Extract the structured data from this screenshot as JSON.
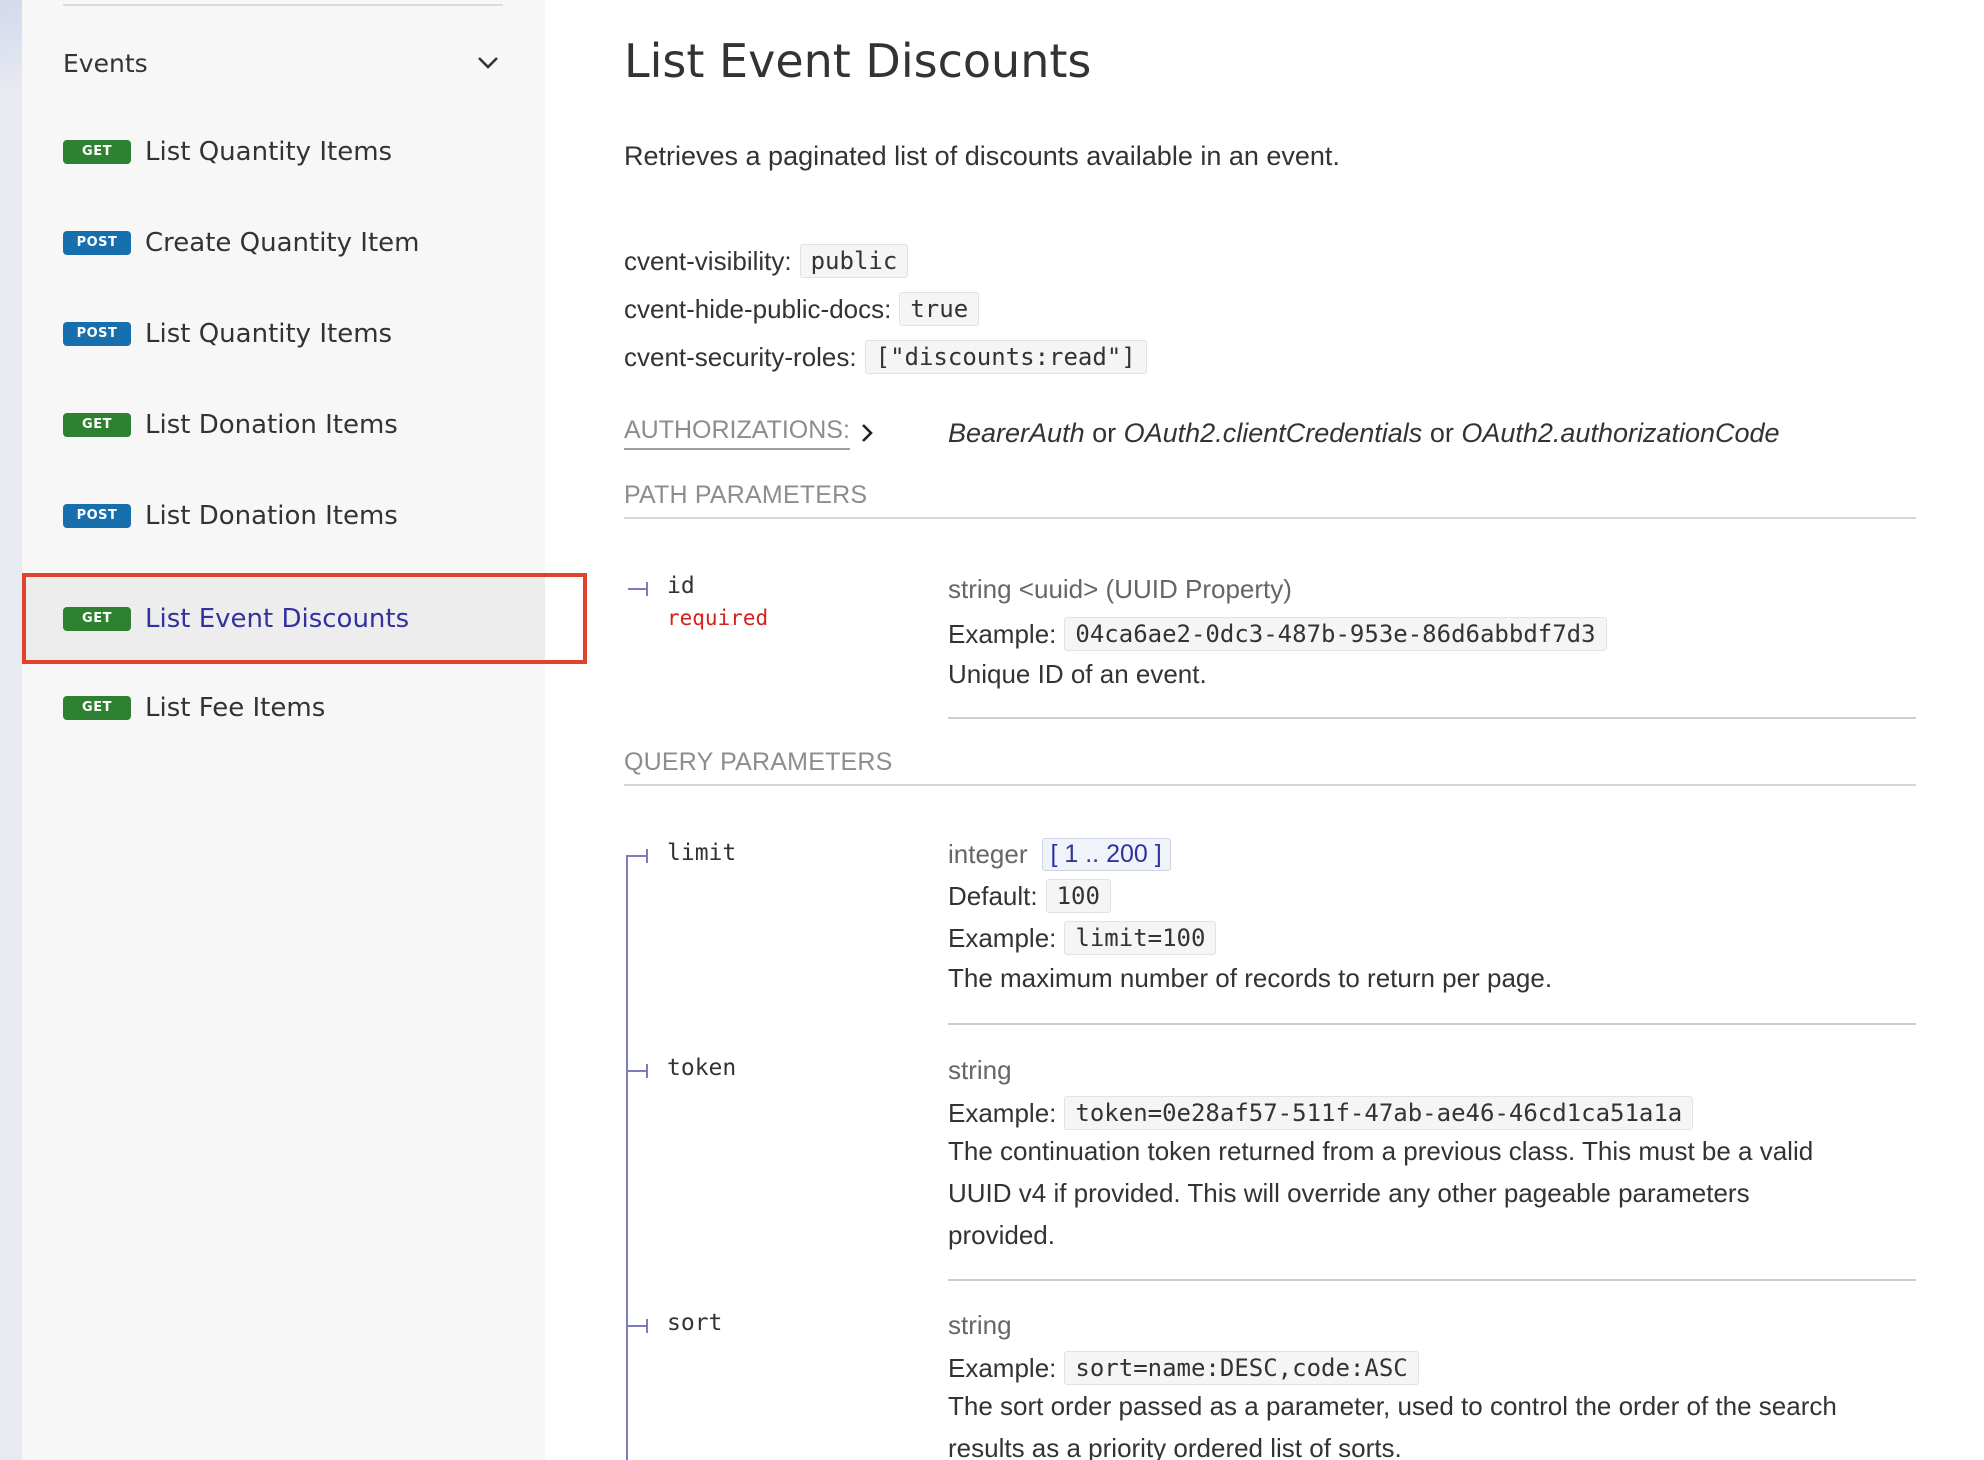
{
  "sidebar": {
    "group_label": "Events",
    "items": [
      {
        "method": "GET",
        "label": "List Quantity Items"
      },
      {
        "method": "POST",
        "label": "Create Quantity Item"
      },
      {
        "method": "POST",
        "label": "List Quantity Items"
      },
      {
        "method": "GET",
        "label": "List Donation Items"
      },
      {
        "method": "POST",
        "label": "List Donation Items"
      },
      {
        "method": "GET",
        "label": "List Event Discounts",
        "active": true
      },
      {
        "method": "GET",
        "label": "List Fee Items"
      }
    ]
  },
  "main": {
    "title": "List Event Discounts",
    "description": "Retrieves a paginated list of discounts available in an event.",
    "extensions": [
      {
        "key": "cvent-visibility:",
        "value": "public"
      },
      {
        "key": "cvent-hide-public-docs:",
        "value": "true"
      },
      {
        "key": "cvent-security-roles:",
        "value": "[\"discounts:read\"]"
      }
    ],
    "authorizations": {
      "label": "AUTHORIZATIONS:",
      "schemes": [
        "BearerAuth",
        "OAuth2.clientCredentials",
        "OAuth2.authorizationCode"
      ],
      "separator": "or"
    },
    "path_parameters": {
      "title": "PATH PARAMETERS",
      "params": [
        {
          "name": "id",
          "required": "required",
          "type": "string <uuid> (UUID Property)",
          "example_label": "Example:",
          "example": "04ca6ae2-0dc3-487b-953e-86d6abbdf7d3",
          "description": "Unique ID of an event."
        }
      ]
    },
    "query_parameters": {
      "title": "QUERY PARAMETERS",
      "params": [
        {
          "name": "limit",
          "type": "integer",
          "range": "[ 1 .. 200 ]",
          "default_label": "Default:",
          "default": "100",
          "example_label": "Example:",
          "example": "limit=100",
          "description": "The maximum number of records to return per page."
        },
        {
          "name": "token",
          "type": "string",
          "example_label": "Example:",
          "example": "token=0e28af57-511f-47ab-ae46-46cd1ca51a1a",
          "description_line1": "The continuation token returned from a previous class. This must be a valid",
          "description_line2": "UUID v4 if provided. This will override any other pageable parameters",
          "description_line3": "provided."
        },
        {
          "name": "sort",
          "type": "string",
          "example_label": "Example:",
          "example": "sort=name:DESC,code:ASC",
          "description_line1": "The sort order passed as a parameter, used to control the order of the search",
          "description_line2": "results as a priority ordered list of sorts."
        }
      ]
    }
  },
  "colors": {
    "get_badge": "#2f8132",
    "post_badge": "#186fae",
    "active_link": "#32329f",
    "required": "#d41f1c",
    "highlight_border": "#e0432b"
  }
}
